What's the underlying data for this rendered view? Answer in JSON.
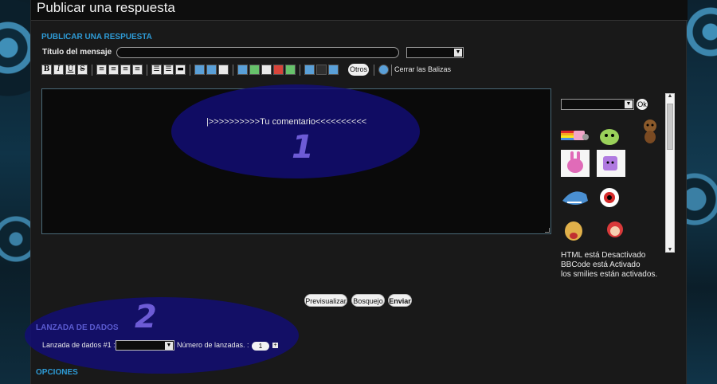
{
  "page": {
    "title": "Publicar una respuesta"
  },
  "post": {
    "section_title": "PUBLICAR UNA RESPUESTA",
    "subject_label": "Título del mensaje",
    "subject_value": "",
    "icon_select_value": ""
  },
  "toolbar": {
    "buttons": [
      {
        "name": "bold-button",
        "glyph": "B"
      },
      {
        "name": "italic-button",
        "glyph": "I"
      },
      {
        "name": "underline-button",
        "glyph": "U"
      },
      {
        "name": "strike-button",
        "glyph": "S"
      },
      {
        "name": "align-left-button",
        "glyph": "≡"
      },
      {
        "name": "align-center-button",
        "glyph": "≡"
      },
      {
        "name": "align-right-button",
        "glyph": "≡"
      },
      {
        "name": "justify-button",
        "glyph": "≡"
      },
      {
        "name": "list-bullet-button",
        "glyph": "☰"
      },
      {
        "name": "list-number-button",
        "glyph": "☰"
      },
      {
        "name": "hr-button",
        "glyph": "▬"
      }
    ],
    "otros_label": "Otros",
    "cerrar_label": "Cerrar las Balizas"
  },
  "editor": {
    "content": "|>>>>>>>>>>Tu comentario<<<<<<<<<<"
  },
  "annotations": {
    "one": "1",
    "two": "2"
  },
  "smilies": {
    "select_value": "",
    "ok_label": "Ok",
    "status": [
      "HTML está Desactivado",
      "BBCode está Activado",
      "los smilies están activados."
    ]
  },
  "actions": {
    "preview_label": "Previsualizar",
    "draft_label": "Bosquejo",
    "send_label": "Enviar"
  },
  "dice": {
    "section_title": "LANZADA DE DADOS",
    "dice_label": "Lanzada de dados #1 :",
    "dice_value": "",
    "rolls_label": "Número de lanzadas. :",
    "rolls_value": "1",
    "plus": "+"
  },
  "options": {
    "section_title": "OPCIONES"
  },
  "colors": {
    "accent": "#2e9bd6",
    "annotation_fill": "#120e78",
    "annotation_text": "#6d5bd6"
  }
}
